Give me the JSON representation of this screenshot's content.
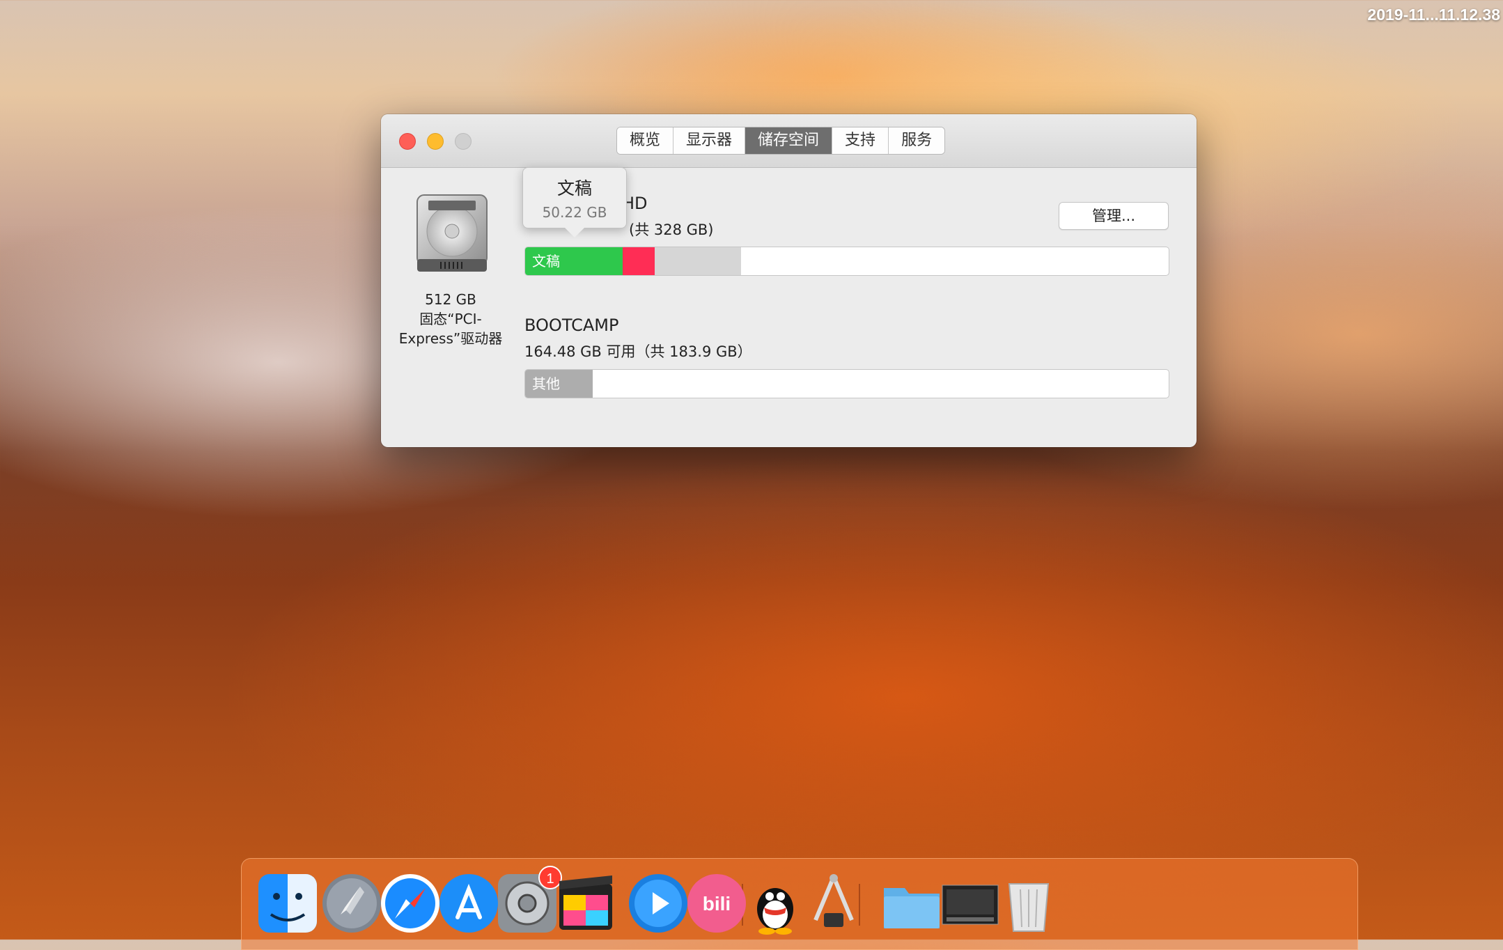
{
  "menubar": {
    "clock": "2019-11...11.12.38"
  },
  "window": {
    "tabs": [
      "概览",
      "显示器",
      "储存空间",
      "支持",
      "服务"
    ],
    "active_tab": "储存空间",
    "drive": {
      "capacity": "512 GB",
      "type_line1": "固态“PCI-",
      "type_line2": "Express”驱动器"
    },
    "volumes": [
      {
        "name": "HD",
        "subtitle": "(共 328 GB)",
        "segments": [
          {
            "label": "文稿",
            "fraction": 0.152,
            "color": "#2ec84c"
          },
          {
            "label": "",
            "fraction": 0.049,
            "color": "#ff2d55"
          },
          {
            "label": "",
            "fraction": 0.135,
            "color": "#d6d6d6"
          }
        ]
      },
      {
        "name": "BOOTCAMP",
        "subtitle": "164.48 GB 可用（共 183.9 GB）",
        "segments": [
          {
            "label": "其他",
            "fraction": 0.105,
            "color": "#adadad"
          }
        ]
      }
    ],
    "manage_button": "管理...",
    "tooltip": {
      "title": "文稿",
      "value": "50.22 GB"
    }
  },
  "dock": {
    "items": [
      "finder-icon",
      "launchpad-icon",
      "safari-icon",
      "app-store-icon",
      "system-preferences-icon",
      "final-cut-pro-icon",
      "quicktime-icon",
      "bilibili-icon",
      "qq-icon",
      "system-information-icon",
      "folder-icon",
      "screenshot-icon",
      "trash-icon"
    ],
    "system_preferences_badge": "1"
  }
}
